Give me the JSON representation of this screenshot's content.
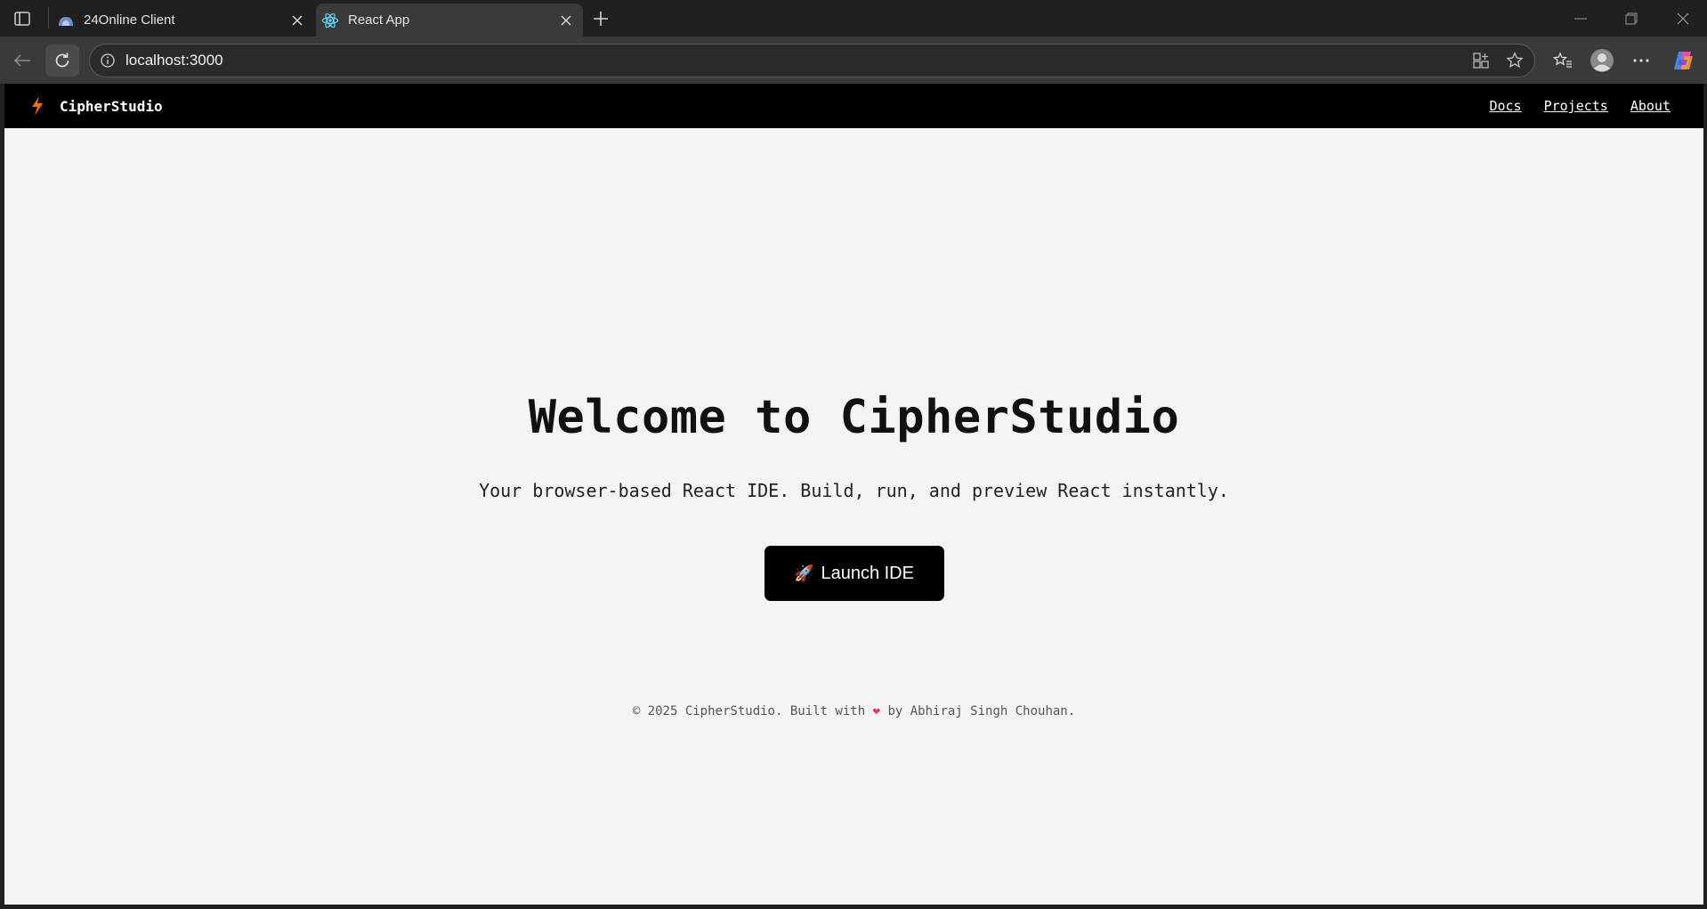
{
  "browser": {
    "tabs": [
      {
        "title": "24Online Client",
        "favicon": "cloud-icon",
        "active": false
      },
      {
        "title": "React App",
        "favicon": "react-icon",
        "active": true
      }
    ],
    "address": "localhost:3000"
  },
  "nav": {
    "brand": "CipherStudio",
    "links": [
      "Docs",
      "Projects",
      "About"
    ]
  },
  "hero": {
    "title": "Welcome to CipherStudio",
    "subtitle": "Your browser-based React IDE. Build, run, and preview React instantly.",
    "button_icon": "🚀",
    "button_label": "Launch IDE"
  },
  "footer": {
    "prefix": "© 2025 CipherStudio. Built with",
    "heart": "❤",
    "suffix": "by Abhiraj Singh Chouhan."
  },
  "colors": {
    "nav_bg": "#000000",
    "page_bg": "#f4f4f4",
    "accent": "#ff6a00"
  }
}
